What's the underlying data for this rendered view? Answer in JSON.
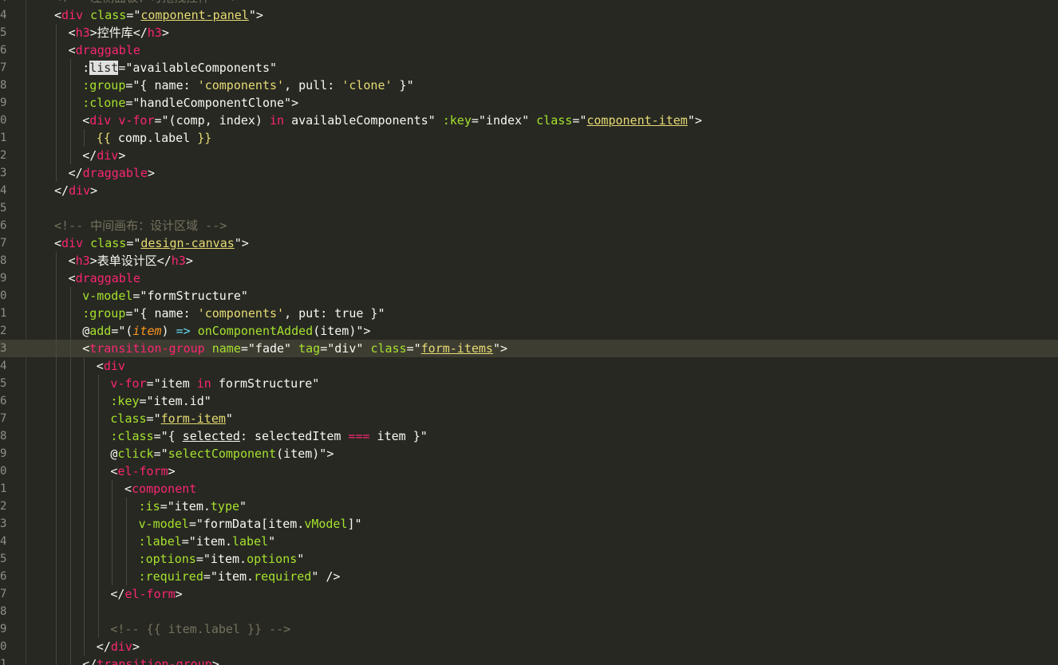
{
  "editor": {
    "lines": [
      {
        "num": "4",
        "indent": 0,
        "active": false,
        "tokens": [
          {
            "t": "<!-- 左侧面板：可拖拽控件 -->",
            "c": "comment"
          }
        ]
      },
      {
        "num": "4",
        "indent": 0,
        "active": false,
        "tokens": [
          {
            "t": "<",
            "c": "punct"
          },
          {
            "t": "div",
            "c": "tag"
          },
          {
            "t": " "
          },
          {
            "t": "class",
            "c": "attr"
          },
          {
            "t": "=\"",
            "c": "str"
          },
          {
            "t": "component-panel",
            "c": "strlit",
            "u": 1
          },
          {
            "t": "\">",
            "c": "punct"
          }
        ]
      },
      {
        "num": "5",
        "indent": 1,
        "active": false,
        "tokens": [
          {
            "t": "<",
            "c": "punct"
          },
          {
            "t": "h3",
            "c": "tag"
          },
          {
            "t": ">控件库</",
            "c": "punct"
          },
          {
            "t": "h3",
            "c": "tag"
          },
          {
            "t": ">",
            "c": "punct"
          }
        ]
      },
      {
        "num": "6",
        "indent": 1,
        "active": false,
        "tokens": [
          {
            "t": "<",
            "c": "punct"
          },
          {
            "t": "draggable",
            "c": "tag"
          }
        ]
      },
      {
        "num": "7",
        "indent": 2,
        "active": false,
        "tokens": [
          {
            "t": ":"
          },
          {
            "t": "list",
            "c": "sel"
          },
          {
            "t": "=\"availableComponents\"",
            "c": "str"
          }
        ]
      },
      {
        "num": "8",
        "indent": 2,
        "active": false,
        "tokens": [
          {
            "t": ":group",
            "c": "attr"
          },
          {
            "t": "=\"{ name: "
          },
          {
            "t": "'components'",
            "c": "strlit"
          },
          {
            "t": ", pull: "
          },
          {
            "t": "'clone'",
            "c": "strlit"
          },
          {
            "t": " }\""
          }
        ]
      },
      {
        "num": "9",
        "indent": 2,
        "active": false,
        "tokens": [
          {
            "t": ":clone",
            "c": "attr"
          },
          {
            "t": "=\"handleComponentClone\">"
          }
        ]
      },
      {
        "num": "0",
        "indent": 2,
        "active": false,
        "tokens": [
          {
            "t": "<"
          },
          {
            "t": "div",
            "c": "tag"
          },
          {
            "t": " "
          },
          {
            "t": "v-for",
            "c": "kw"
          },
          {
            "t": "=\"(comp, index) "
          },
          {
            "t": "in",
            "c": "kw"
          },
          {
            "t": " availableComponents\" "
          },
          {
            "t": ":key",
            "c": "attr"
          },
          {
            "t": "=\"index\" "
          },
          {
            "t": "class",
            "c": "attr"
          },
          {
            "t": "=\""
          },
          {
            "t": "component-item",
            "c": "strlit",
            "u": 1
          },
          {
            "t": "\">"
          }
        ]
      },
      {
        "num": "1",
        "indent": 3,
        "active": false,
        "tokens": [
          {
            "t": "{{",
            "c": "strlit"
          },
          {
            "t": " comp.label "
          },
          {
            "t": "}}",
            "c": "strlit"
          }
        ]
      },
      {
        "num": "2",
        "indent": 2,
        "active": false,
        "tokens": [
          {
            "t": "</"
          },
          {
            "t": "div",
            "c": "tag"
          },
          {
            "t": ">"
          }
        ]
      },
      {
        "num": "3",
        "indent": 1,
        "active": false,
        "tokens": [
          {
            "t": "</"
          },
          {
            "t": "draggable",
            "c": "tag"
          },
          {
            "t": ">"
          }
        ]
      },
      {
        "num": "4",
        "indent": 0,
        "active": false,
        "tokens": [
          {
            "t": "</"
          },
          {
            "t": "div",
            "c": "tag"
          },
          {
            "t": ">"
          }
        ]
      },
      {
        "num": "5",
        "indent": 0,
        "active": false,
        "tokens": []
      },
      {
        "num": "6",
        "indent": 0,
        "active": false,
        "tokens": [
          {
            "t": "<!-- 中间画布：设计区域 -->",
            "c": "comment"
          }
        ]
      },
      {
        "num": "7",
        "indent": 0,
        "active": false,
        "tokens": [
          {
            "t": "<"
          },
          {
            "t": "div",
            "c": "tag"
          },
          {
            "t": " "
          },
          {
            "t": "class",
            "c": "attr"
          },
          {
            "t": "=\""
          },
          {
            "t": "design-canvas",
            "c": "strlit",
            "u": 1
          },
          {
            "t": "\">"
          }
        ]
      },
      {
        "num": "8",
        "indent": 1,
        "active": false,
        "tokens": [
          {
            "t": "<"
          },
          {
            "t": "h3",
            "c": "tag"
          },
          {
            "t": ">表单设计区</"
          },
          {
            "t": "h3",
            "c": "tag"
          },
          {
            "t": ">"
          }
        ]
      },
      {
        "num": "9",
        "indent": 1,
        "active": false,
        "tokens": [
          {
            "t": "<"
          },
          {
            "t": "draggable",
            "c": "tag"
          }
        ]
      },
      {
        "num": "0",
        "indent": 2,
        "active": false,
        "tokens": [
          {
            "t": "v-model",
            "c": "attr"
          },
          {
            "t": "=\"formStructure\""
          }
        ]
      },
      {
        "num": "1",
        "indent": 2,
        "active": false,
        "tokens": [
          {
            "t": ":group",
            "c": "attr"
          },
          {
            "t": "=\"{ name: "
          },
          {
            "t": "'components'",
            "c": "strlit"
          },
          {
            "t": ", put: true }\""
          }
        ]
      },
      {
        "num": "2",
        "indent": 2,
        "active": false,
        "tokens": [
          {
            "t": "@"
          },
          {
            "t": "add",
            "c": "attr"
          },
          {
            "t": "=\"("
          },
          {
            "t": "item",
            "c": "param"
          },
          {
            "t": ") "
          },
          {
            "t": "=>",
            "c": "arrow"
          },
          {
            "t": " "
          },
          {
            "t": "onComponentAdded",
            "c": "fn"
          },
          {
            "t": "(item)\">"
          }
        ]
      },
      {
        "num": "3",
        "indent": 2,
        "active": true,
        "tokens": [
          {
            "t": "<"
          },
          {
            "t": "transition-group",
            "c": "tag"
          },
          {
            "t": " "
          },
          {
            "t": "name",
            "c": "attr"
          },
          {
            "t": "=\"fade\" "
          },
          {
            "t": "tag",
            "c": "attr"
          },
          {
            "t": "=\"div\" "
          },
          {
            "t": "class",
            "c": "attr"
          },
          {
            "t": "=\""
          },
          {
            "t": "form-items",
            "c": "strlit",
            "u": 1
          },
          {
            "t": "\">"
          }
        ]
      },
      {
        "num": "4",
        "indent": 3,
        "active": false,
        "tokens": [
          {
            "t": "<"
          },
          {
            "t": "div",
            "c": "tag"
          }
        ]
      },
      {
        "num": "5",
        "indent": 4,
        "active": false,
        "tokens": [
          {
            "t": "v-for",
            "c": "kw"
          },
          {
            "t": "=\"item "
          },
          {
            "t": "in",
            "c": "kw"
          },
          {
            "t": " formStructure\""
          }
        ]
      },
      {
        "num": "6",
        "indent": 4,
        "active": false,
        "tokens": [
          {
            "t": ":key",
            "c": "attr"
          },
          {
            "t": "=\"item.id\""
          }
        ]
      },
      {
        "num": "7",
        "indent": 4,
        "active": false,
        "tokens": [
          {
            "t": "class",
            "c": "attr"
          },
          {
            "t": "=\""
          },
          {
            "t": "form-item",
            "c": "strlit",
            "u": 1
          },
          {
            "t": "\""
          }
        ]
      },
      {
        "num": "8",
        "indent": 4,
        "active": false,
        "tokens": [
          {
            "t": ":class",
            "c": "attr"
          },
          {
            "t": "=\"{ "
          },
          {
            "t": "selected",
            "c": "str",
            "uw": 1
          },
          {
            "t": ": selectedItem "
          },
          {
            "t": "===",
            "c": "kw"
          },
          {
            "t": " item }\""
          }
        ]
      },
      {
        "num": "9",
        "indent": 4,
        "active": false,
        "tokens": [
          {
            "t": "@"
          },
          {
            "t": "click",
            "c": "attr"
          },
          {
            "t": "=\""
          },
          {
            "t": "selectComponent",
            "c": "fn"
          },
          {
            "t": "(item)\">"
          }
        ]
      },
      {
        "num": "0",
        "indent": 4,
        "active": false,
        "tokens": [
          {
            "t": "<"
          },
          {
            "t": "el-form",
            "c": "tag"
          },
          {
            "t": ">"
          }
        ]
      },
      {
        "num": "1",
        "indent": 5,
        "active": false,
        "tokens": [
          {
            "t": "<"
          },
          {
            "t": "component",
            "c": "tag"
          }
        ]
      },
      {
        "num": "2",
        "indent": 6,
        "active": false,
        "tokens": [
          {
            "t": ":is",
            "c": "attr"
          },
          {
            "t": "=\"item."
          },
          {
            "t": "type",
            "c": "prop"
          },
          {
            "t": "\""
          }
        ]
      },
      {
        "num": "3",
        "indent": 6,
        "active": false,
        "tokens": [
          {
            "t": "v-model",
            "c": "attr"
          },
          {
            "t": "=\"formData[item."
          },
          {
            "t": "vModel",
            "c": "prop"
          },
          {
            "t": "]\""
          }
        ]
      },
      {
        "num": "4",
        "indent": 6,
        "active": false,
        "tokens": [
          {
            "t": ":label",
            "c": "attr"
          },
          {
            "t": "=\"item."
          },
          {
            "t": "label",
            "c": "prop"
          },
          {
            "t": "\""
          }
        ]
      },
      {
        "num": "5",
        "indent": 6,
        "active": false,
        "tokens": [
          {
            "t": ":options",
            "c": "attr"
          },
          {
            "t": "=\"item."
          },
          {
            "t": "options",
            "c": "prop"
          },
          {
            "t": "\""
          }
        ]
      },
      {
        "num": "6",
        "indent": 6,
        "active": false,
        "tokens": [
          {
            "t": ":required",
            "c": "attr"
          },
          {
            "t": "=\"item."
          },
          {
            "t": "required",
            "c": "prop"
          },
          {
            "t": "\" />"
          }
        ]
      },
      {
        "num": "7",
        "indent": 4,
        "active": false,
        "tokens": [
          {
            "t": "</"
          },
          {
            "t": "el-form",
            "c": "tag"
          },
          {
            "t": ">"
          }
        ]
      },
      {
        "num": "8",
        "indent": 4,
        "active": false,
        "tokens": []
      },
      {
        "num": "9",
        "indent": 4,
        "active": false,
        "tokens": [
          {
            "t": "<!-- {{ item.label }} -->",
            "c": "comment"
          }
        ]
      },
      {
        "num": "0",
        "indent": 3,
        "active": false,
        "tokens": [
          {
            "t": "</"
          },
          {
            "t": "div",
            "c": "tag"
          },
          {
            "t": ">"
          }
        ]
      },
      {
        "num": "1",
        "indent": 2,
        "active": false,
        "tokens": [
          {
            "t": "</"
          },
          {
            "t": "transition-group",
            "c": "tag"
          },
          {
            "t": ">"
          }
        ]
      }
    ]
  }
}
